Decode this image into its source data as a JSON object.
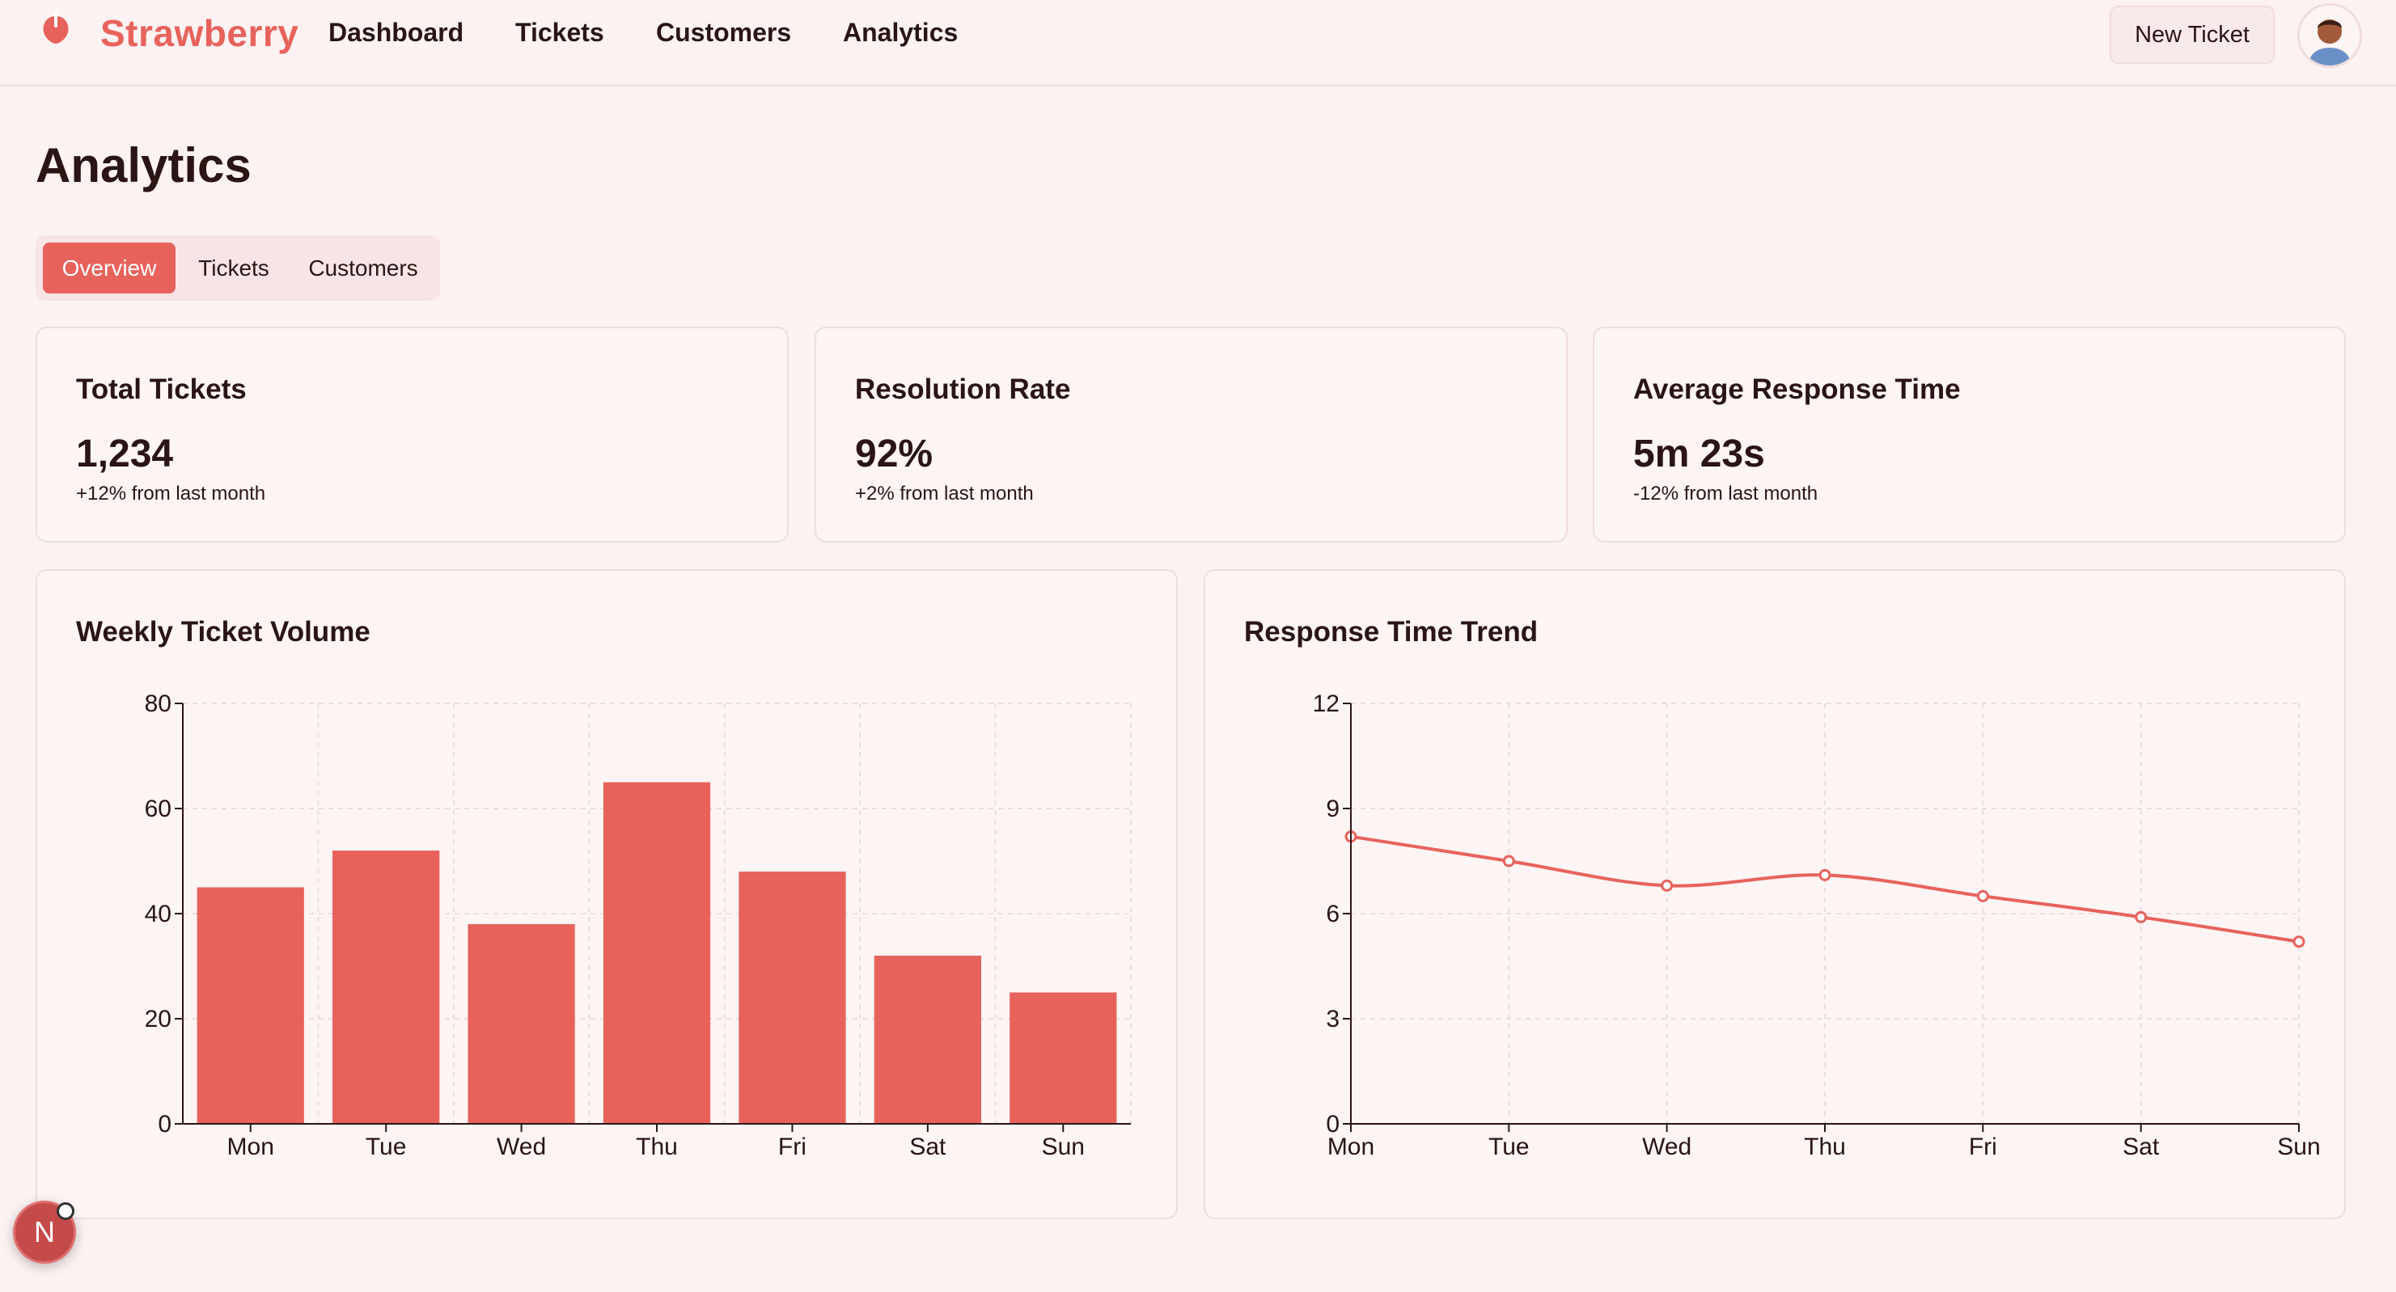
{
  "app": {
    "brand": "Strawberry"
  },
  "nav": {
    "links": [
      "Dashboard",
      "Tickets",
      "Customers",
      "Analytics"
    ]
  },
  "header": {
    "new_ticket_label": "New Ticket"
  },
  "page": {
    "title": "Analytics"
  },
  "tabs": [
    {
      "label": "Overview",
      "active": true
    },
    {
      "label": "Tickets",
      "active": false
    },
    {
      "label": "Customers",
      "active": false
    }
  ],
  "stats": [
    {
      "title": "Total Tickets",
      "value": "1,234",
      "delta": "+12% from last month"
    },
    {
      "title": "Resolution Rate",
      "value": "92%",
      "delta": "+2% from last month"
    },
    {
      "title": "Average Response Time",
      "value": "5m 23s",
      "delta": "-12% from last month"
    }
  ],
  "colors": {
    "accent": "#e8625c",
    "background": "#fcf2f2",
    "text": "#2a1414"
  },
  "fab": {
    "label": "N"
  },
  "chart_data": [
    {
      "type": "bar",
      "title": "Weekly Ticket Volume",
      "categories": [
        "Mon",
        "Tue",
        "Wed",
        "Thu",
        "Fri",
        "Sat",
        "Sun"
      ],
      "values": [
        45,
        52,
        38,
        65,
        48,
        32,
        25
      ],
      "ylim": [
        0,
        80
      ],
      "yticks": [
        0,
        20,
        40,
        60,
        80
      ],
      "grid": true,
      "color": "#e8625c"
    },
    {
      "type": "line",
      "title": "Response Time Trend",
      "categories": [
        "Mon",
        "Tue",
        "Wed",
        "Thu",
        "Fri",
        "Sat",
        "Sun"
      ],
      "values": [
        8.2,
        7.5,
        6.8,
        7.1,
        6.5,
        5.9,
        5.2
      ],
      "ylim": [
        0,
        12
      ],
      "yticks": [
        0,
        3,
        6,
        9,
        12
      ],
      "grid": true,
      "color": "#e8625c"
    }
  ]
}
